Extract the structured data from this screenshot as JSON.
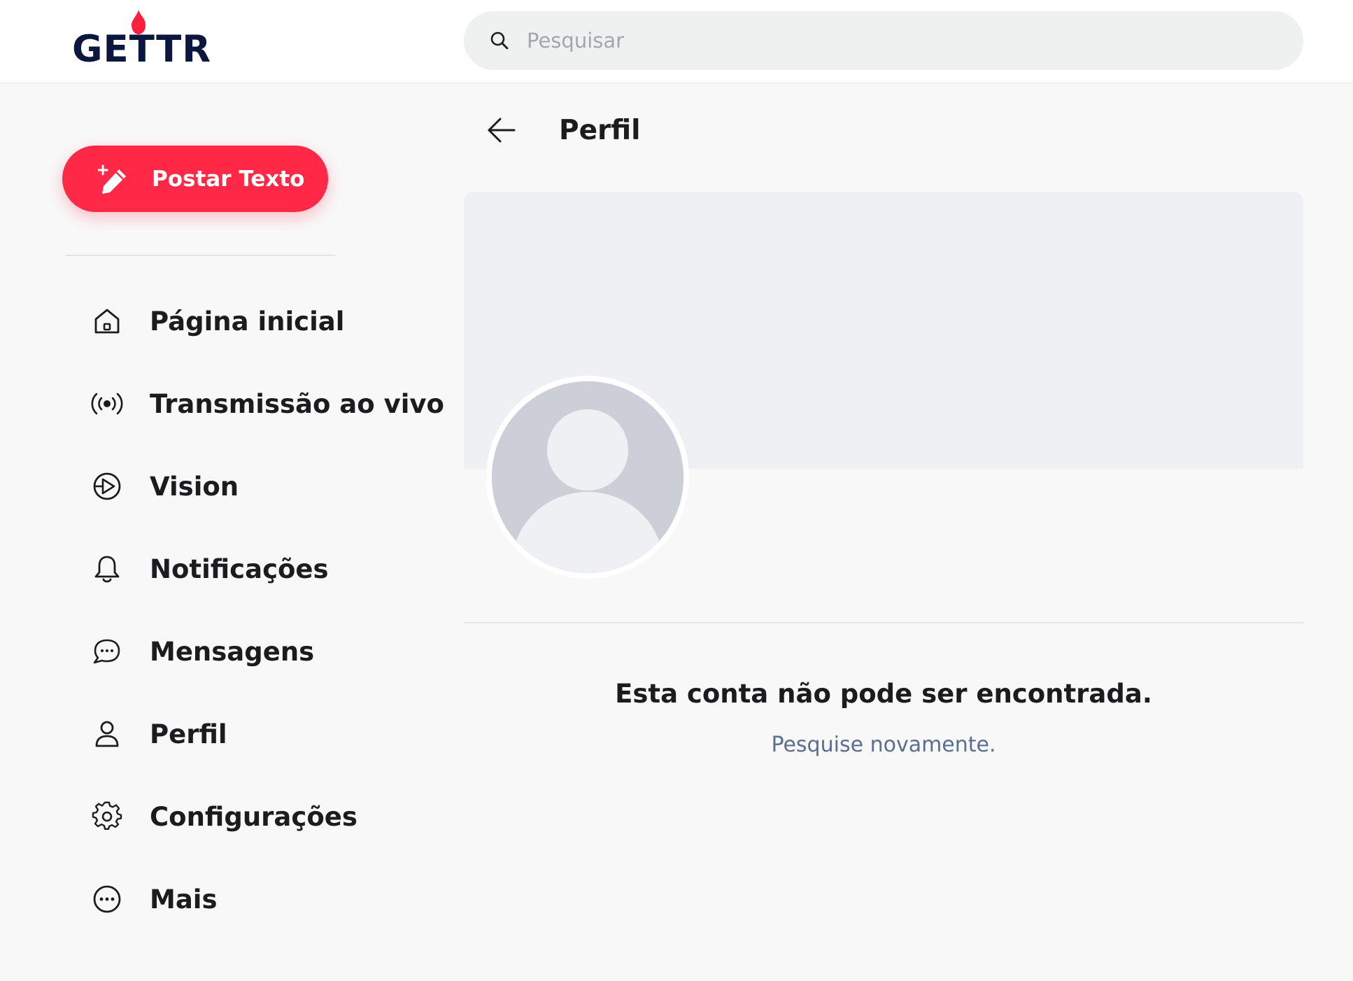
{
  "header": {
    "logo_text": "GETTR",
    "search": {
      "placeholder": "Pesquisar",
      "icon": "search-icon"
    }
  },
  "sidebar": {
    "post_button": {
      "label": "Postar Texto",
      "icon": "magic-pencil-icon",
      "color": "#ff2846"
    },
    "items": [
      {
        "label": "Página inicial",
        "icon": "home-icon"
      },
      {
        "label": "Transmissão ao vivo",
        "icon": "live-broadcast-icon"
      },
      {
        "label": "Vision",
        "icon": "vision-play-icon"
      },
      {
        "label": "Notificações",
        "icon": "bell-icon"
      },
      {
        "label": "Mensagens",
        "icon": "chat-bubbles-icon"
      },
      {
        "label": "Perfil",
        "icon": "user-icon"
      },
      {
        "label": "Configurações",
        "icon": "gear-icon"
      },
      {
        "label": "Mais",
        "icon": "more-dots-icon"
      }
    ]
  },
  "main": {
    "title": "Perfil",
    "back_icon": "arrow-left-icon",
    "not_found_message": "Esta conta não pode ser encontrada.",
    "search_again_link": "Pesquise novamente.",
    "link_color": "#5b6e8f"
  }
}
